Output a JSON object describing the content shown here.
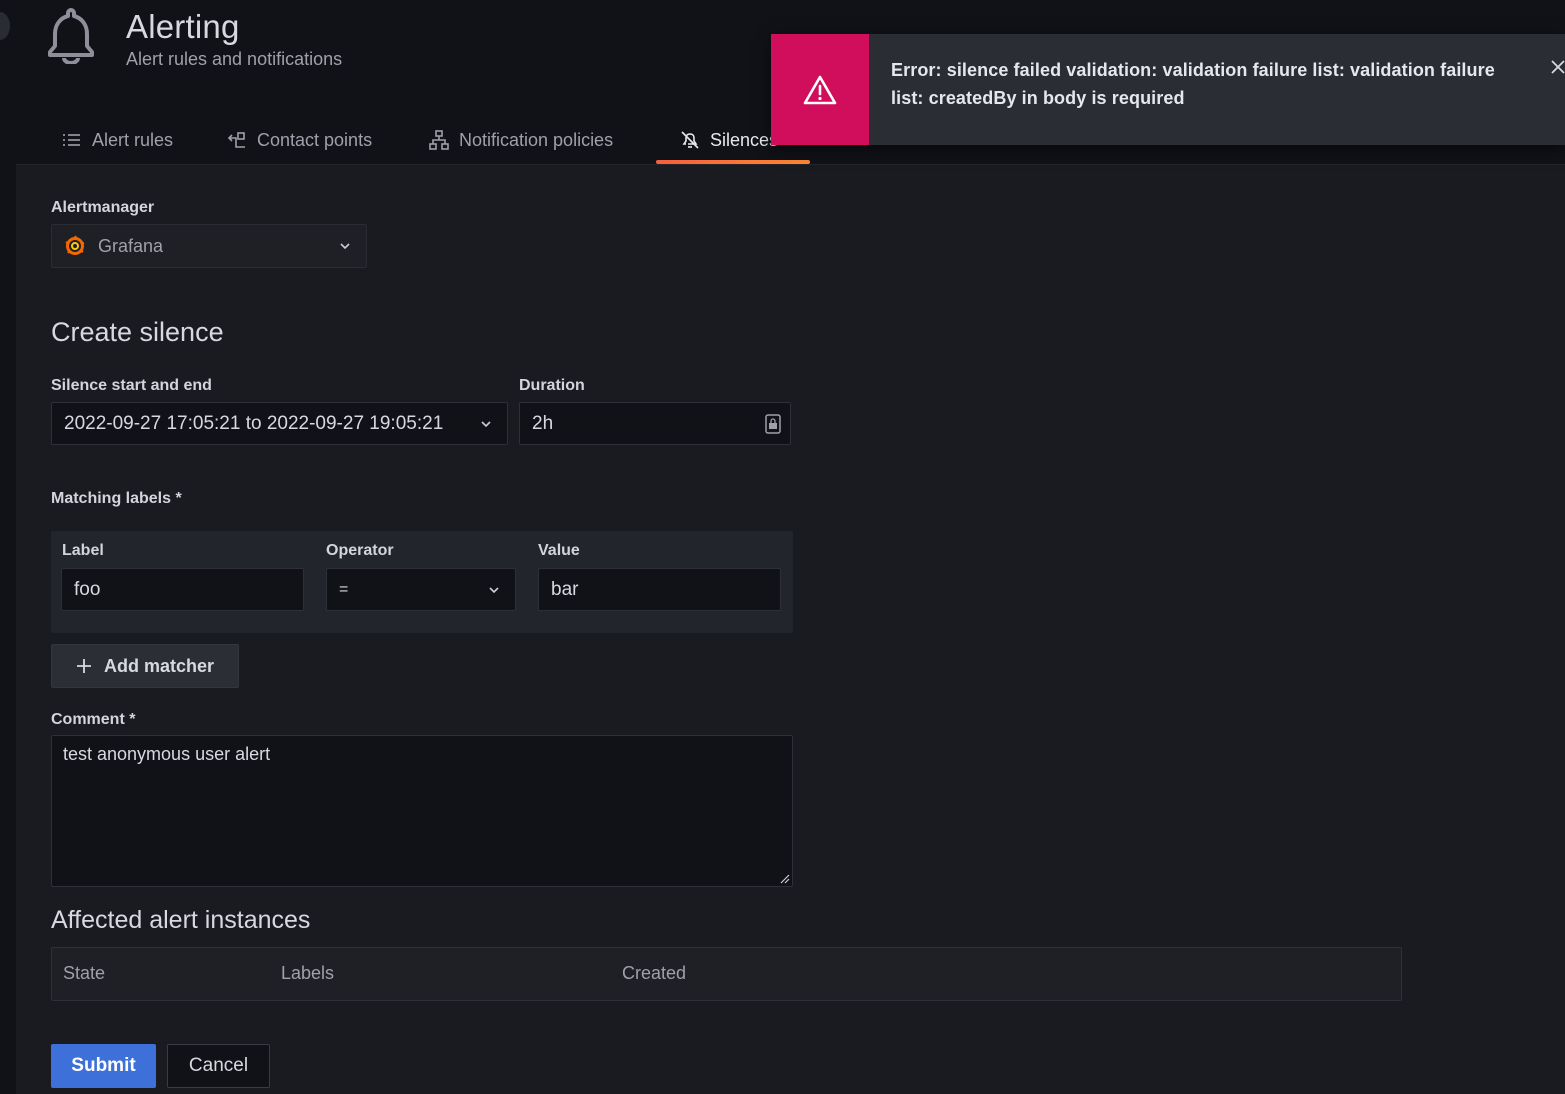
{
  "header": {
    "title": "Alerting",
    "subtitle": "Alert rules and notifications"
  },
  "tabs": [
    {
      "label": "Alert rules",
      "icon": "list-icon"
    },
    {
      "label": "Contact points",
      "icon": "contact-points-icon"
    },
    {
      "label": "Notification policies",
      "icon": "sitemap-icon"
    },
    {
      "label": "Silences",
      "icon": "bell-slash-icon",
      "active": true
    }
  ],
  "alertmanager": {
    "label": "Alertmanager",
    "selected": "Grafana"
  },
  "form": {
    "title": "Create silence",
    "range_label": "Silence start and end",
    "range_value": "2022-09-27 17:05:21 to 2022-09-27 19:05:21",
    "duration_label": "Duration",
    "duration_value": "2h",
    "matching_label": "Matching labels *",
    "matcher": {
      "label_header": "Label",
      "operator_header": "Operator",
      "value_header": "Value",
      "label_value": "foo",
      "operator_value": "=",
      "value_value": "bar"
    },
    "add_matcher": "Add matcher",
    "comment_label": "Comment *",
    "comment_value": "test anonymous user alert"
  },
  "affected": {
    "title": "Affected alert instances",
    "columns": [
      "State",
      "Labels",
      "Created"
    ]
  },
  "actions": {
    "submit": "Submit",
    "cancel": "Cancel"
  },
  "toast": {
    "message": "Error: silence failed validation: validation failure list: validation failure list: createdBy in body is required",
    "color": "#d10e5c"
  },
  "colors": {
    "accent": "#3d71d9",
    "tab_underline": "#ff8833"
  }
}
